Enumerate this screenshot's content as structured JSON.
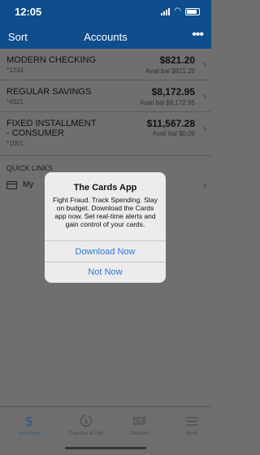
{
  "status_bar": {
    "time": "12:05"
  },
  "nav": {
    "left_label": "Sort",
    "title": "Accounts",
    "more": "•••"
  },
  "accounts": [
    {
      "name": "MODERN CHECKING",
      "number": "*1234",
      "balance": "$821.20",
      "available": "Avail bal $821.20"
    },
    {
      "name": "REGULAR SAVINGS",
      "number": "*4321",
      "balance": "$8,172.95",
      "available": "Avail bal $8,172.95"
    },
    {
      "name": "FIXED INSTALLMENT\n- CONSUMER",
      "number": "*1001",
      "balance": "$11,567.28",
      "available": "Avail bal $0.00"
    }
  ],
  "quick_links": {
    "header": "QUICK LINKS",
    "items": [
      {
        "label": "My"
      }
    ]
  },
  "modal": {
    "title": "The Cards App",
    "body": "Fight Fraud. Track Spending. Stay on budget. Download the Cards app now. Set real-time alerts and gain control of your cards.",
    "primary": "Download Now",
    "secondary": "Not Now"
  },
  "tabs": [
    {
      "label": "Accounts",
      "icon": "dollar-icon"
    },
    {
      "label": "Transfer & Pay",
      "icon": "transfer-pay-icon"
    },
    {
      "label": "Deposit",
      "icon": "deposit-icon"
    },
    {
      "label": "More",
      "icon": "menu-icon"
    }
  ],
  "colors": {
    "brand": "#0f4d8c",
    "link": "#2f76d8",
    "overlay": "#6f6f6f"
  }
}
